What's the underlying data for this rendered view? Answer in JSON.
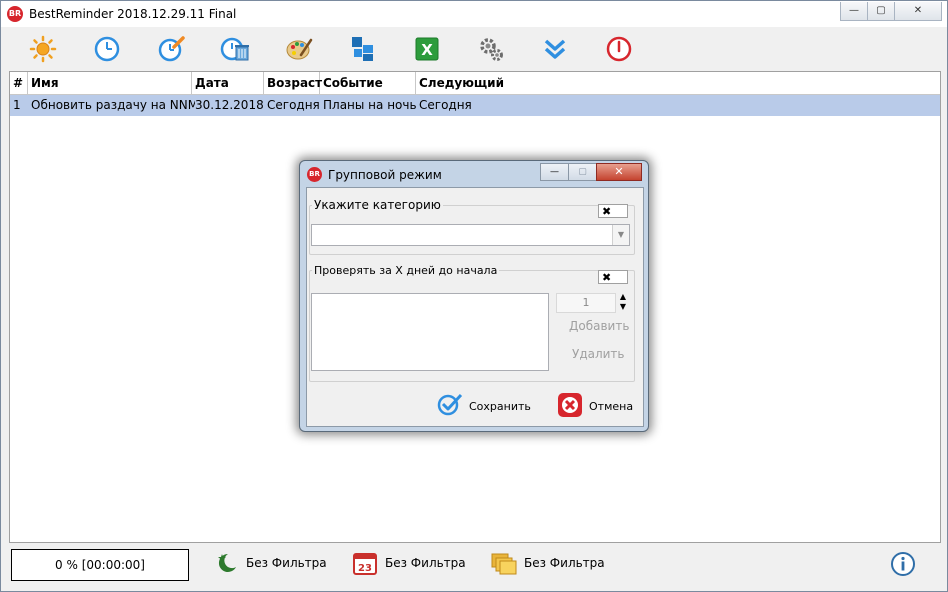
{
  "window": {
    "title": "BestReminder 2018.12.29.11 Final",
    "app_icon_text": "BR",
    "controls": {
      "minimize": "—",
      "maximize": "▢",
      "close": "✕"
    }
  },
  "toolbar": {
    "buttons": [
      {
        "icon": "sun-icon"
      },
      {
        "icon": "clock-icon"
      },
      {
        "icon": "clock-edit-icon"
      },
      {
        "icon": "clock-delete-icon"
      },
      {
        "icon": "palette-icon"
      },
      {
        "icon": "blocks-icon"
      },
      {
        "icon": "excel-icon"
      },
      {
        "icon": "gears-icon"
      },
      {
        "icon": "double-chevron-down-icon"
      },
      {
        "icon": "power-icon"
      }
    ]
  },
  "grid": {
    "columns": [
      "#",
      "Имя",
      "Дата",
      "Возраст",
      "Событие",
      "Следующий"
    ],
    "rows": [
      [
        "1",
        "Обновить раздачу на NNM",
        "30.12.2018",
        "Сегодня",
        "Планы на ночь",
        "Сегодня"
      ]
    ]
  },
  "statusbar": {
    "progress": "0 % [00:00:00]",
    "filters": [
      "Без Фильтра",
      "Без Фильтра",
      "Без Фильтра"
    ]
  },
  "dialog": {
    "title": "Групповой режим",
    "icon_text": "BR",
    "category_label": "Укажите категорию",
    "category_value": "",
    "days_label": "Проверять за X дней до начала",
    "days_value": "1",
    "clear_glyph": "✖",
    "add_label": "Добавить",
    "remove_label": "Удалить",
    "save_label": "Сохранить",
    "cancel_label": "Отмена"
  },
  "colors": {
    "selection": "#b9cbe9",
    "accent_blue": "#2f8fe0",
    "accent_red": "#d7262d",
    "accent_green": "#2d9c3c"
  }
}
